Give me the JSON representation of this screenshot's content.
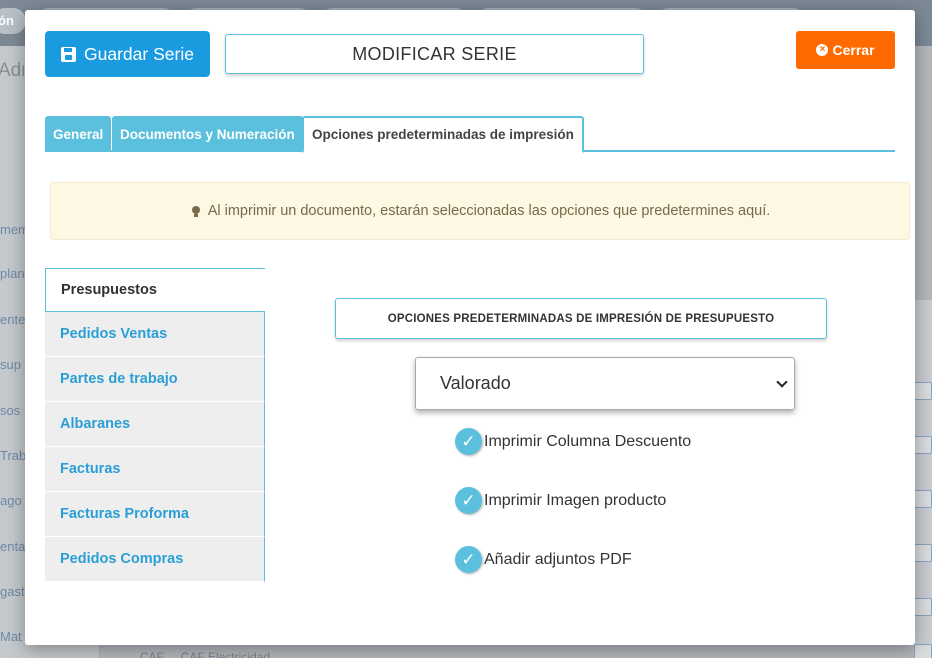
{
  "background": {
    "top_pill": "ón",
    "sidebar_title": "Adn",
    "sidebar_items": [
      "mem",
      "plan",
      "ente",
      "sup",
      "sos",
      "Trab",
      "ago",
      "enta",
      "gast",
      "Mat"
    ],
    "bottom_text": "CAF   ...   CAF   Electricidad"
  },
  "modal": {
    "save_label": "Guardar Serie",
    "title": "MODIFICAR SERIE",
    "close_label": "Cerrar",
    "tabs": [
      {
        "label": "General"
      },
      {
        "label": "Documentos y Numeración"
      },
      {
        "label": "Opciones predeterminadas de impresión"
      }
    ],
    "alert_text": "Al imprimir un documento, estarán seleccionadas las opciones que predetermines aquí.",
    "doc_nav": [
      {
        "label": "Presupuestos"
      },
      {
        "label": "Pedidos Ventas"
      },
      {
        "label": "Partes de trabajo"
      },
      {
        "label": "Albaranes"
      },
      {
        "label": "Facturas"
      },
      {
        "label": "Facturas Proforma"
      },
      {
        "label": "Pedidos Compras"
      }
    ],
    "panel_title": "OPCIONES PREDETERMINADAS DE IMPRESIÓN DE PRESUPUESTO",
    "select_value": "Valorado",
    "options": [
      {
        "label": "Imprimir Columna Descuento"
      },
      {
        "label": "Imprimir Imagen producto"
      },
      {
        "label": "Añadir adjuntos PDF"
      }
    ]
  },
  "colors": {
    "primary": "#1a9be0",
    "info": "#5bc0de",
    "close": "#ff6a00",
    "alert_bg": "#fcf8e3"
  }
}
